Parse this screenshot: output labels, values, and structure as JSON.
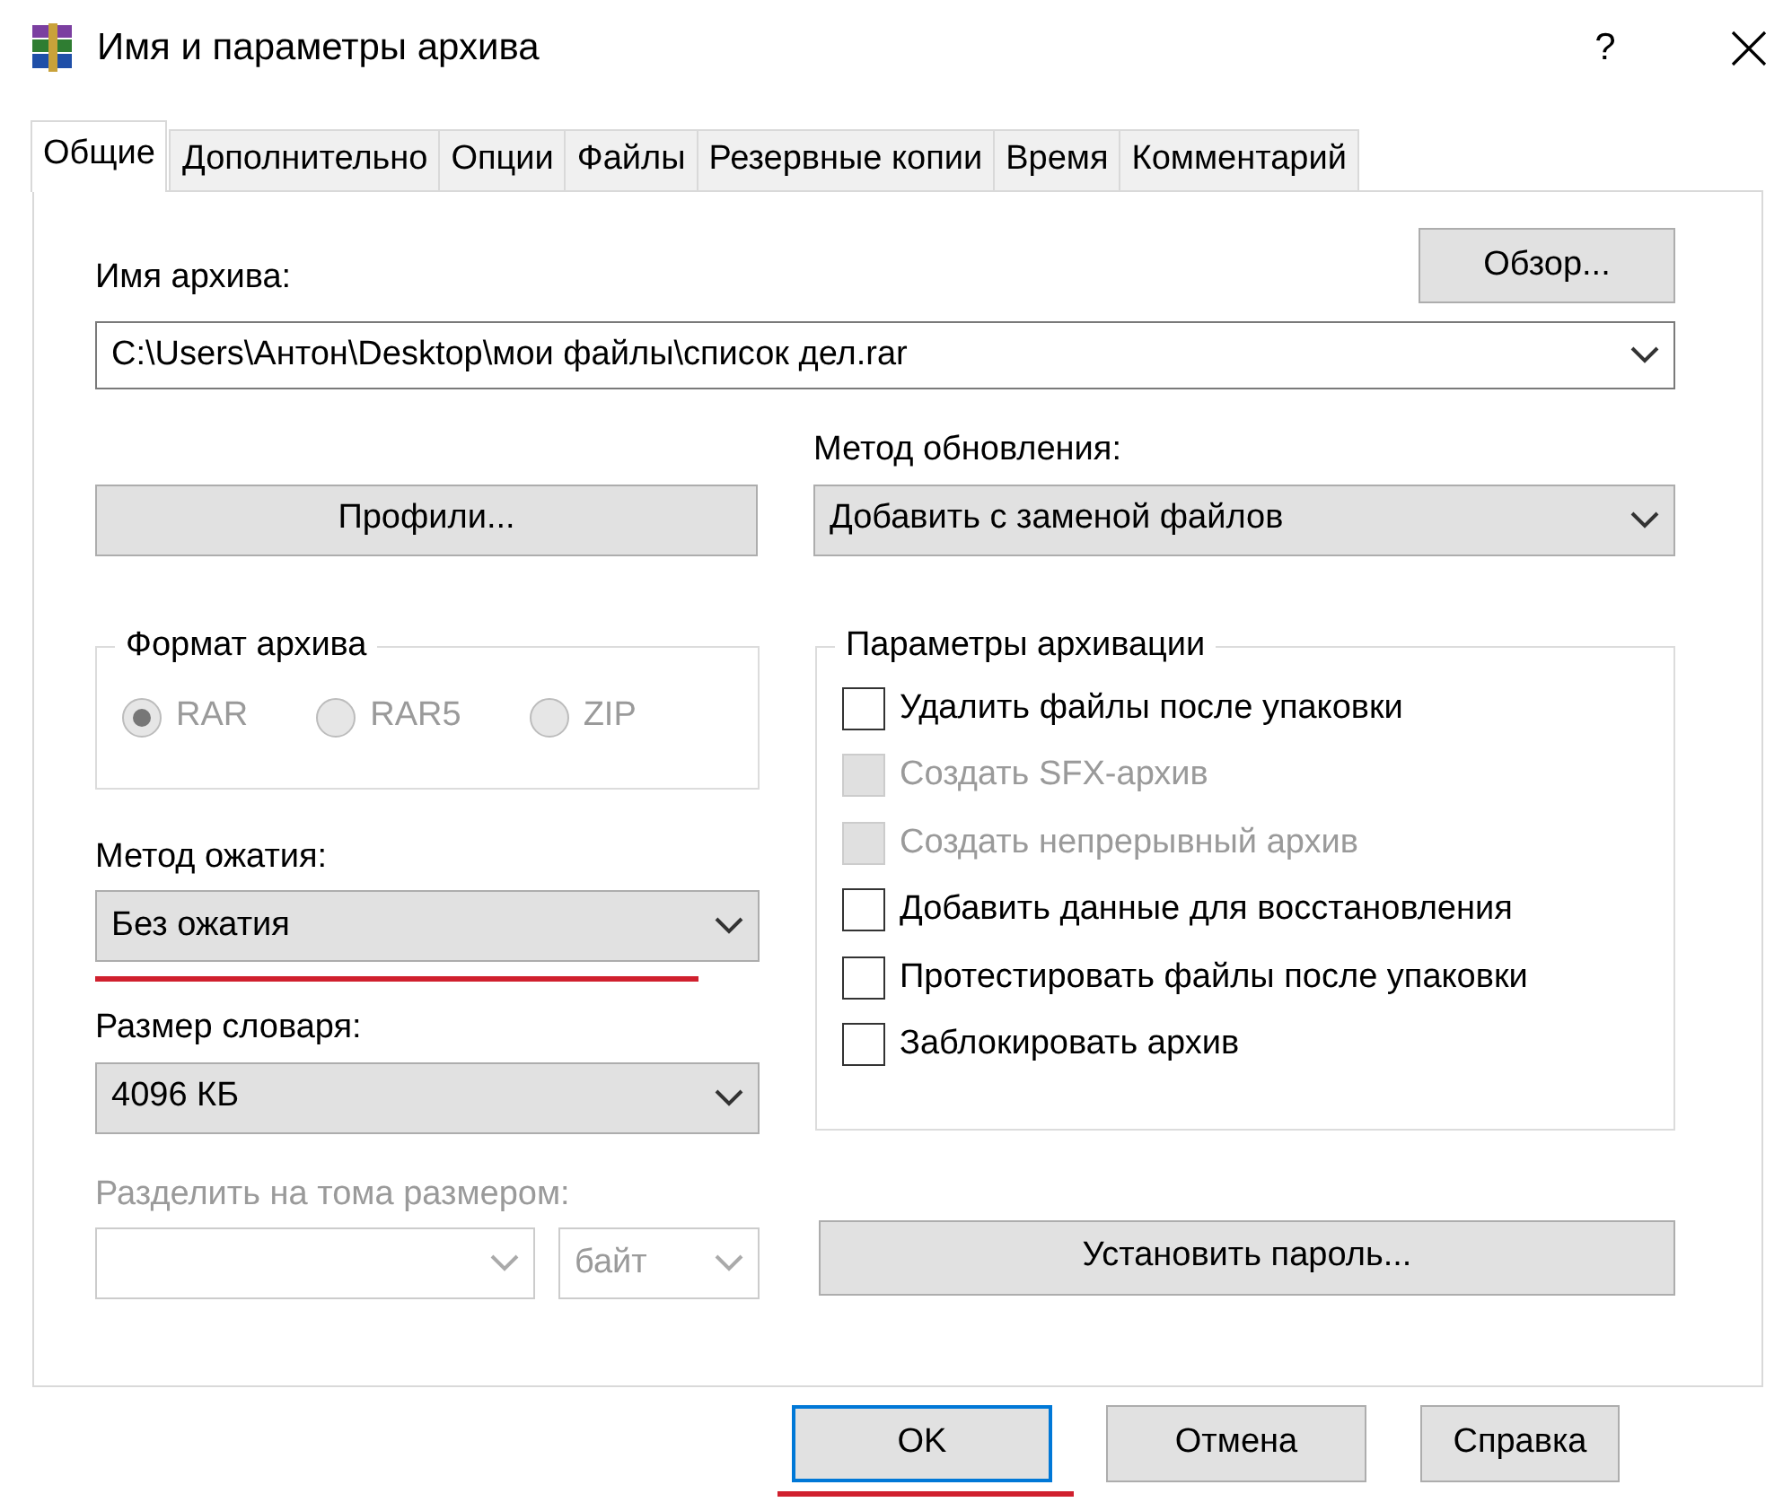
{
  "window": {
    "title": "Имя и параметры архива",
    "help": "?"
  },
  "tabs": [
    {
      "label": "Общие",
      "selected": true
    },
    {
      "label": "Дополнительно",
      "selected": false
    },
    {
      "label": "Опции",
      "selected": false
    },
    {
      "label": "Файлы",
      "selected": false
    },
    {
      "label": "Резервные копии",
      "selected": false
    },
    {
      "label": "Время",
      "selected": false
    },
    {
      "label": "Комментарий",
      "selected": false
    }
  ],
  "archive_name": {
    "label": "Имя архива:",
    "value": "C:\\Users\\Антон\\Desktop\\мои файлы\\список дел.rar",
    "browse": "Обзор..."
  },
  "profiles_button": "Профили...",
  "update_method": {
    "label": "Метод обновления:",
    "value": "Добавить с заменой файлов"
  },
  "archive_format": {
    "title": "Формат архива",
    "options": [
      {
        "label": "RAR",
        "selected": true,
        "disabled": true
      },
      {
        "label": "RAR5",
        "selected": false,
        "disabled": true
      },
      {
        "label": "ZIP",
        "selected": false,
        "disabled": true
      }
    ]
  },
  "compression_method": {
    "label": "Метод ожатия:",
    "value": "Без ожатия",
    "highlighted": true
  },
  "dictionary_size": {
    "label": "Размер словаря:",
    "value": "4096 КБ"
  },
  "split_volumes": {
    "label": "Разделить на тома размером:",
    "disabled": true,
    "unit": "байт"
  },
  "archiving_options": {
    "title": "Параметры архивации",
    "items": [
      {
        "label": "Удалить файлы после упаковки",
        "checked": false,
        "disabled": false
      },
      {
        "label": "Создать SFX-архив",
        "checked": false,
        "disabled": true
      },
      {
        "label": "Создать непрерывный архив",
        "checked": false,
        "disabled": true
      },
      {
        "label": "Добавить данные для восстановления",
        "checked": false,
        "disabled": false
      },
      {
        "label": "Протестировать файлы после упаковки",
        "checked": false,
        "disabled": false
      },
      {
        "label": "Заблокировать архив",
        "checked": false,
        "disabled": false
      }
    ]
  },
  "password_button": "Установить пароль...",
  "buttons": [
    {
      "label": "OK",
      "default": true,
      "highlighted": true
    },
    {
      "label": "Отмена",
      "default": false,
      "highlighted": false
    },
    {
      "label": "Справка",
      "default": false,
      "highlighted": false
    }
  ]
}
